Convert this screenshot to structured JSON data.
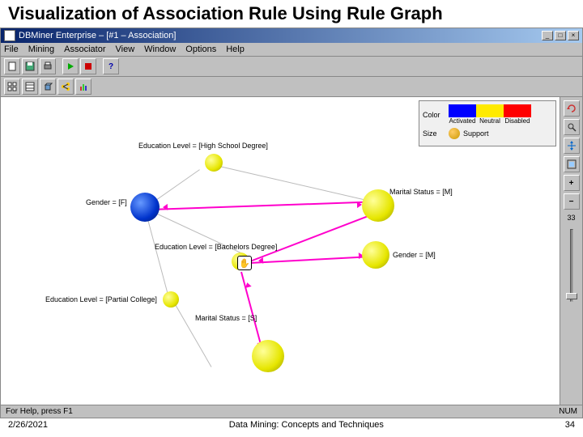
{
  "slide": {
    "title": "Visualization of Association Rule Using Rule Graph",
    "footer_date": "2/26/2021",
    "footer_center": "Data Mining: Concepts and Techniques",
    "footer_page": "34"
  },
  "window": {
    "title": "DBMiner Enterprise – [#1 – Association]"
  },
  "menu": {
    "file": "File",
    "mining": "Mining",
    "associator": "Associator",
    "view": "View",
    "window": "Window",
    "options": "Options",
    "help": "Help"
  },
  "legend": {
    "color_label": "Color",
    "activated": "Activated",
    "neutral": "Neutral",
    "disabled": "Disabled",
    "size_label": "Size",
    "support": "Support",
    "colors": {
      "activated": "#0000ff",
      "neutral": "#ffea00",
      "disabled": "#ff0000"
    }
  },
  "slider": {
    "value": "33"
  },
  "nodes": {
    "n1": {
      "label": "Education Level = [High School Degree]"
    },
    "n2": {
      "label": "Gender = [F]"
    },
    "n3": {
      "label": "Education Level = [Bachelors Degree]"
    },
    "n4": {
      "label": "Education Level = [Partial College]"
    },
    "n5": {
      "label": "Marital Status = [S]"
    },
    "n6": {
      "label": "Marital Status = [M]"
    },
    "n7": {
      "label": "Gender = [M]"
    }
  },
  "status": {
    "left": "For Help, press F1",
    "right": "NUM"
  }
}
